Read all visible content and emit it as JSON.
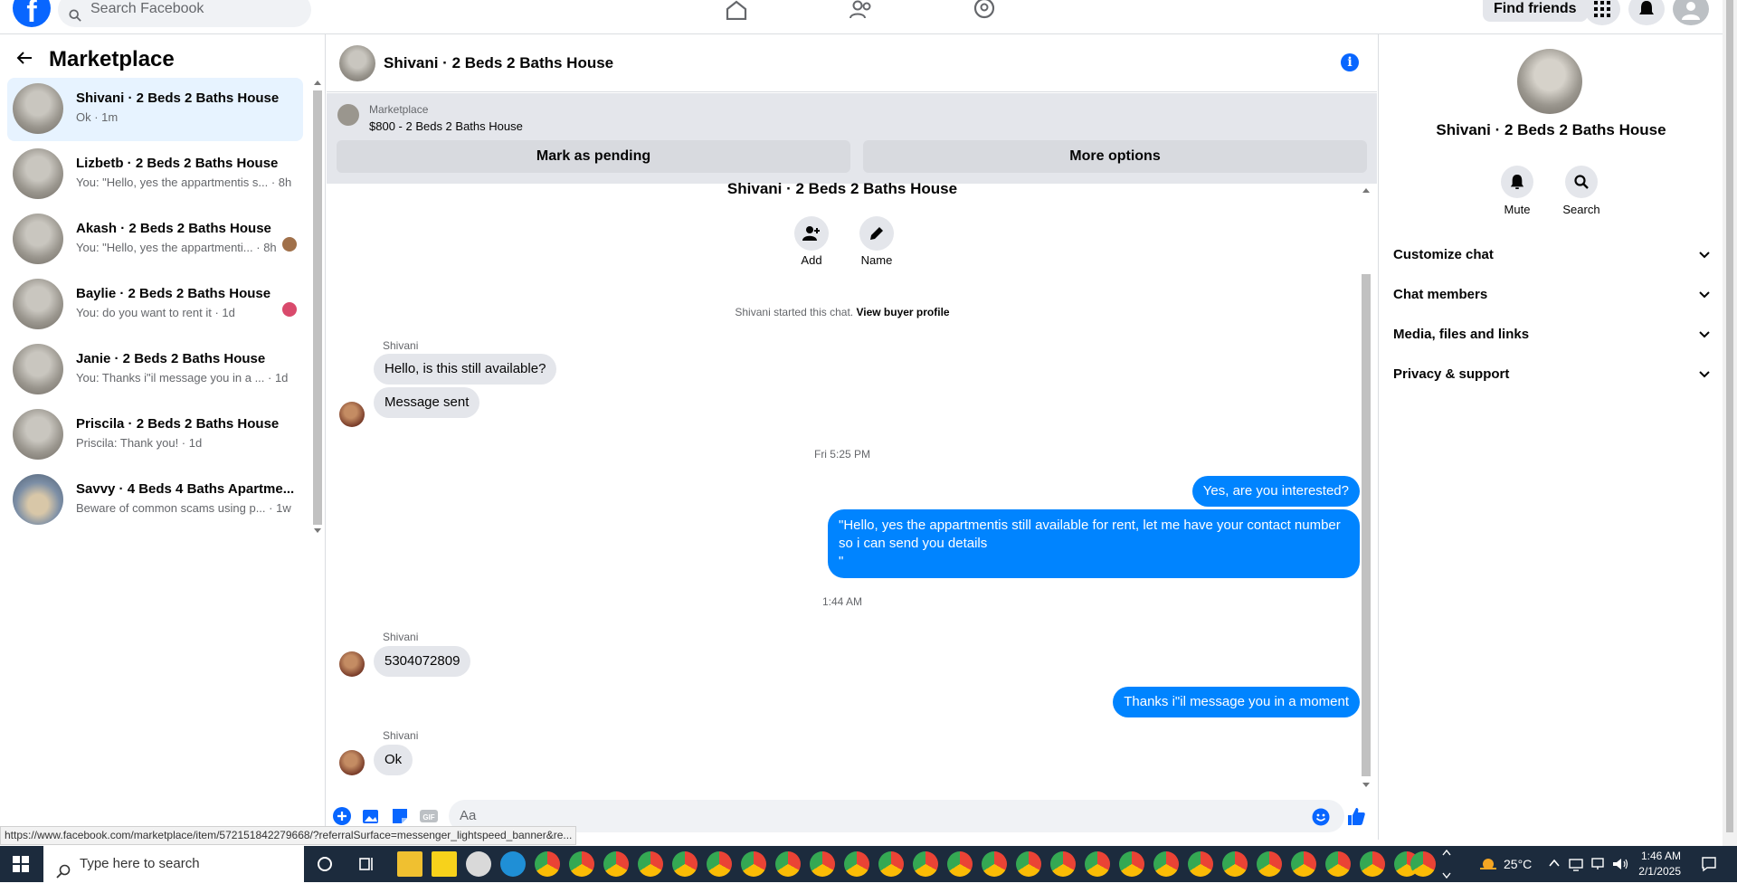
{
  "topnav": {
    "logo": "f",
    "search_placeholder": "Search Facebook",
    "find_friends": "Find friends",
    "icons": [
      "home-icon",
      "friends-icon",
      "groups-icon",
      "menu-grid-icon",
      "bell-icon",
      "account-icon"
    ]
  },
  "sidebar": {
    "title": "Marketplace",
    "conversations": [
      {
        "name": "Shivani · 2 Beds 2 Baths House",
        "preview": "Ok · 1m",
        "active": true
      },
      {
        "name": "Lizbetb · 2 Beds 2 Baths House",
        "preview": "You: \"Hello, yes the appartmentis s... · 8h"
      },
      {
        "name": "Akash · 2 Beds 2 Baths House",
        "preview": "You: \"Hello, yes the appartmenti... · 8h"
      },
      {
        "name": "Baylie · 2 Beds 2 Baths House",
        "preview": "You: do you want to rent it · 1d"
      },
      {
        "name": "Janie · 2 Beds 2 Baths House",
        "preview": "You: Thanks i\"il message you in a ... · 1d"
      },
      {
        "name": "Priscila · 2 Beds 2 Baths House",
        "preview": "Priscila: Thank you! · 1d"
      },
      {
        "name": "Savvy · 4 Beds 4 Baths Apartme...",
        "preview": "Beware of common scams using p... · 1w"
      }
    ]
  },
  "chat": {
    "header_title": "Shivani · 2 Beds 2 Baths House",
    "banner": {
      "label": "Marketplace",
      "price_title": "$800 - 2 Beds 2 Baths House",
      "mark_pending": "Mark as pending",
      "more_options": "More options"
    },
    "conv_title": "Shivani · 2 Beds 2 Baths House",
    "actions": {
      "add": "Add",
      "name": "Name"
    },
    "started_text": "Shivani started this chat.",
    "view_profile": "View buyer profile",
    "sender_name": "Shivani",
    "messages": {
      "m1": "Hello, is this still available?",
      "m2": "Message sent",
      "ts1": "Fri 5:25 PM",
      "m3": "Yes, are you interested?",
      "m4_line1": "\"Hello, yes the appartmentis still available for rent, let me have your contact number",
      "m4_line2": "so i can send you details",
      "m4_line3": "\"",
      "ts2": "1:44 AM",
      "m5": "5304072809",
      "m6": "Thanks i\"il message you in a moment",
      "m7": "Ok"
    },
    "composer_placeholder": "Aa"
  },
  "right_panel": {
    "title": "Shivani · 2 Beds 2 Baths House",
    "mute": "Mute",
    "search": "Search",
    "sections": [
      "Customize chat",
      "Chat members",
      "Media, files and links",
      "Privacy & support"
    ]
  },
  "status_url": "https://www.facebook.com/marketplace/item/572151842279668/?referralSurface=messenger_lightspeed_banner&re...",
  "taskbar": {
    "search_placeholder": "Type here to search",
    "weather": "25°C",
    "time": "1:46 AM",
    "date": "2/1/2025"
  },
  "colors": {
    "accent": "#0866ff",
    "bubble_out": "#0084ff",
    "bubble_in": "#e4e6eb",
    "active_row": "#e7f3ff"
  }
}
